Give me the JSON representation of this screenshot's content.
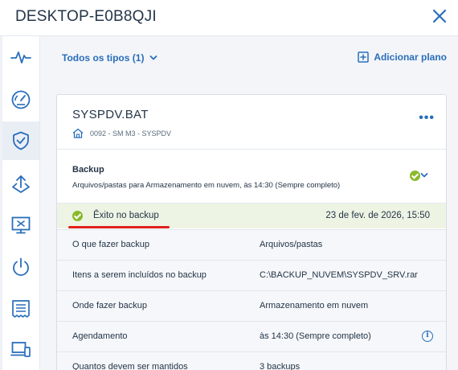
{
  "window": {
    "title": "DESKTOP-E0B8QJI"
  },
  "sidebar": {
    "items": [
      {
        "icon": "activity-icon"
      },
      {
        "icon": "dashboard-gauge-icon"
      },
      {
        "icon": "shield-check-icon",
        "active": true
      },
      {
        "icon": "recovery-icon"
      },
      {
        "icon": "remote-desktop-icon"
      },
      {
        "icon": "power-icon"
      },
      {
        "icon": "report-icon"
      },
      {
        "icon": "devices-icon"
      }
    ]
  },
  "toolbar": {
    "filter_label": "Todos os tipos (1)",
    "add_plan_label": "Adicionar plano"
  },
  "card": {
    "title": "SYSPDV.BAT",
    "subtitle": "0092 - SM M3 - SYSPDV",
    "more_label": "•••",
    "backup": {
      "title": "Backup",
      "description": "Arquivos/pastas para Armazenamento em nuvem, às 14:30 (Sempre completo)"
    },
    "status": {
      "label": "Êxito no backup",
      "time": "23 de fev. de 2026, 15:50"
    },
    "details": [
      {
        "key": "O que fazer backup",
        "value": "Arquivos/pastas"
      },
      {
        "key": "Itens a serem incluídos no backup",
        "value": "C:\\BACKUP_NUVEM\\SYSPDV_SRV.rar"
      },
      {
        "key": "Onde fazer backup",
        "value": "Armazenamento em nuvem"
      },
      {
        "key": "Agendamento",
        "value": "às 14:30 (Sempre completo)"
      },
      {
        "key": "Quantos devem ser mantidos",
        "value": "3 backups"
      }
    ]
  },
  "colors": {
    "accent": "#2a6ebb",
    "success": "#8ab92d",
    "status_bg": "#eef4e4",
    "annotation": "#e0201e"
  }
}
